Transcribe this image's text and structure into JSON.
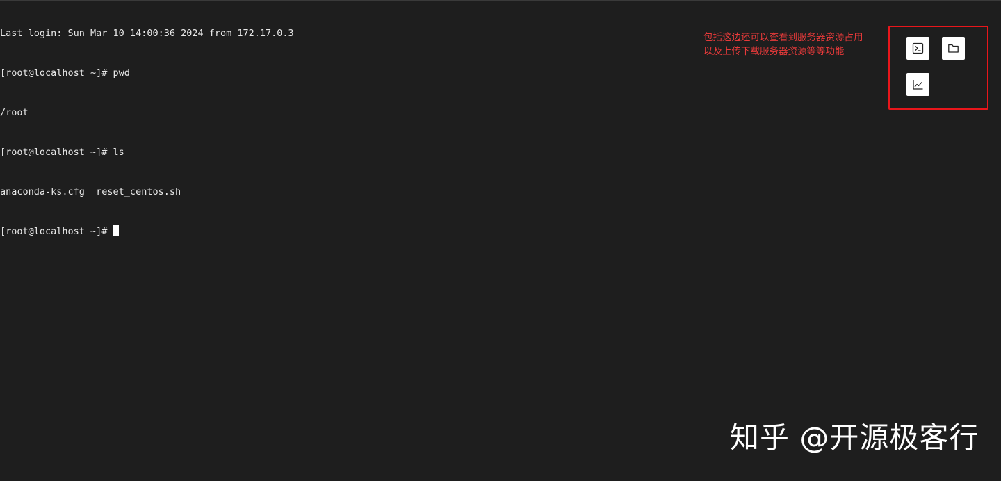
{
  "terminal": {
    "lines": [
      "Last login: Sun Mar 10 14:00:36 2024 from 172.17.0.3",
      "[root@localhost ~]# pwd",
      "/root",
      "[root@localhost ~]# ls",
      "anaconda-ks.cfg  reset_centos.sh"
    ],
    "prompt": "[root@localhost ~]# "
  },
  "annotation": {
    "line1": "包括这边还可以查看到服务器资源占用",
    "line2": "以及上传下载服务器资源等等功能",
    "color": "#e83a3a"
  },
  "toolbar": {
    "buttons": [
      {
        "name": "terminal",
        "icon": "terminal-icon"
      },
      {
        "name": "files",
        "icon": "folder-icon"
      },
      {
        "name": "monitor",
        "icon": "line-chart-icon"
      }
    ],
    "highlight_color": "#e8161b"
  },
  "watermark": {
    "text": "知乎 @开源极客行"
  },
  "colors": {
    "background": "#1e1e1e",
    "text": "#e8e8e8"
  }
}
